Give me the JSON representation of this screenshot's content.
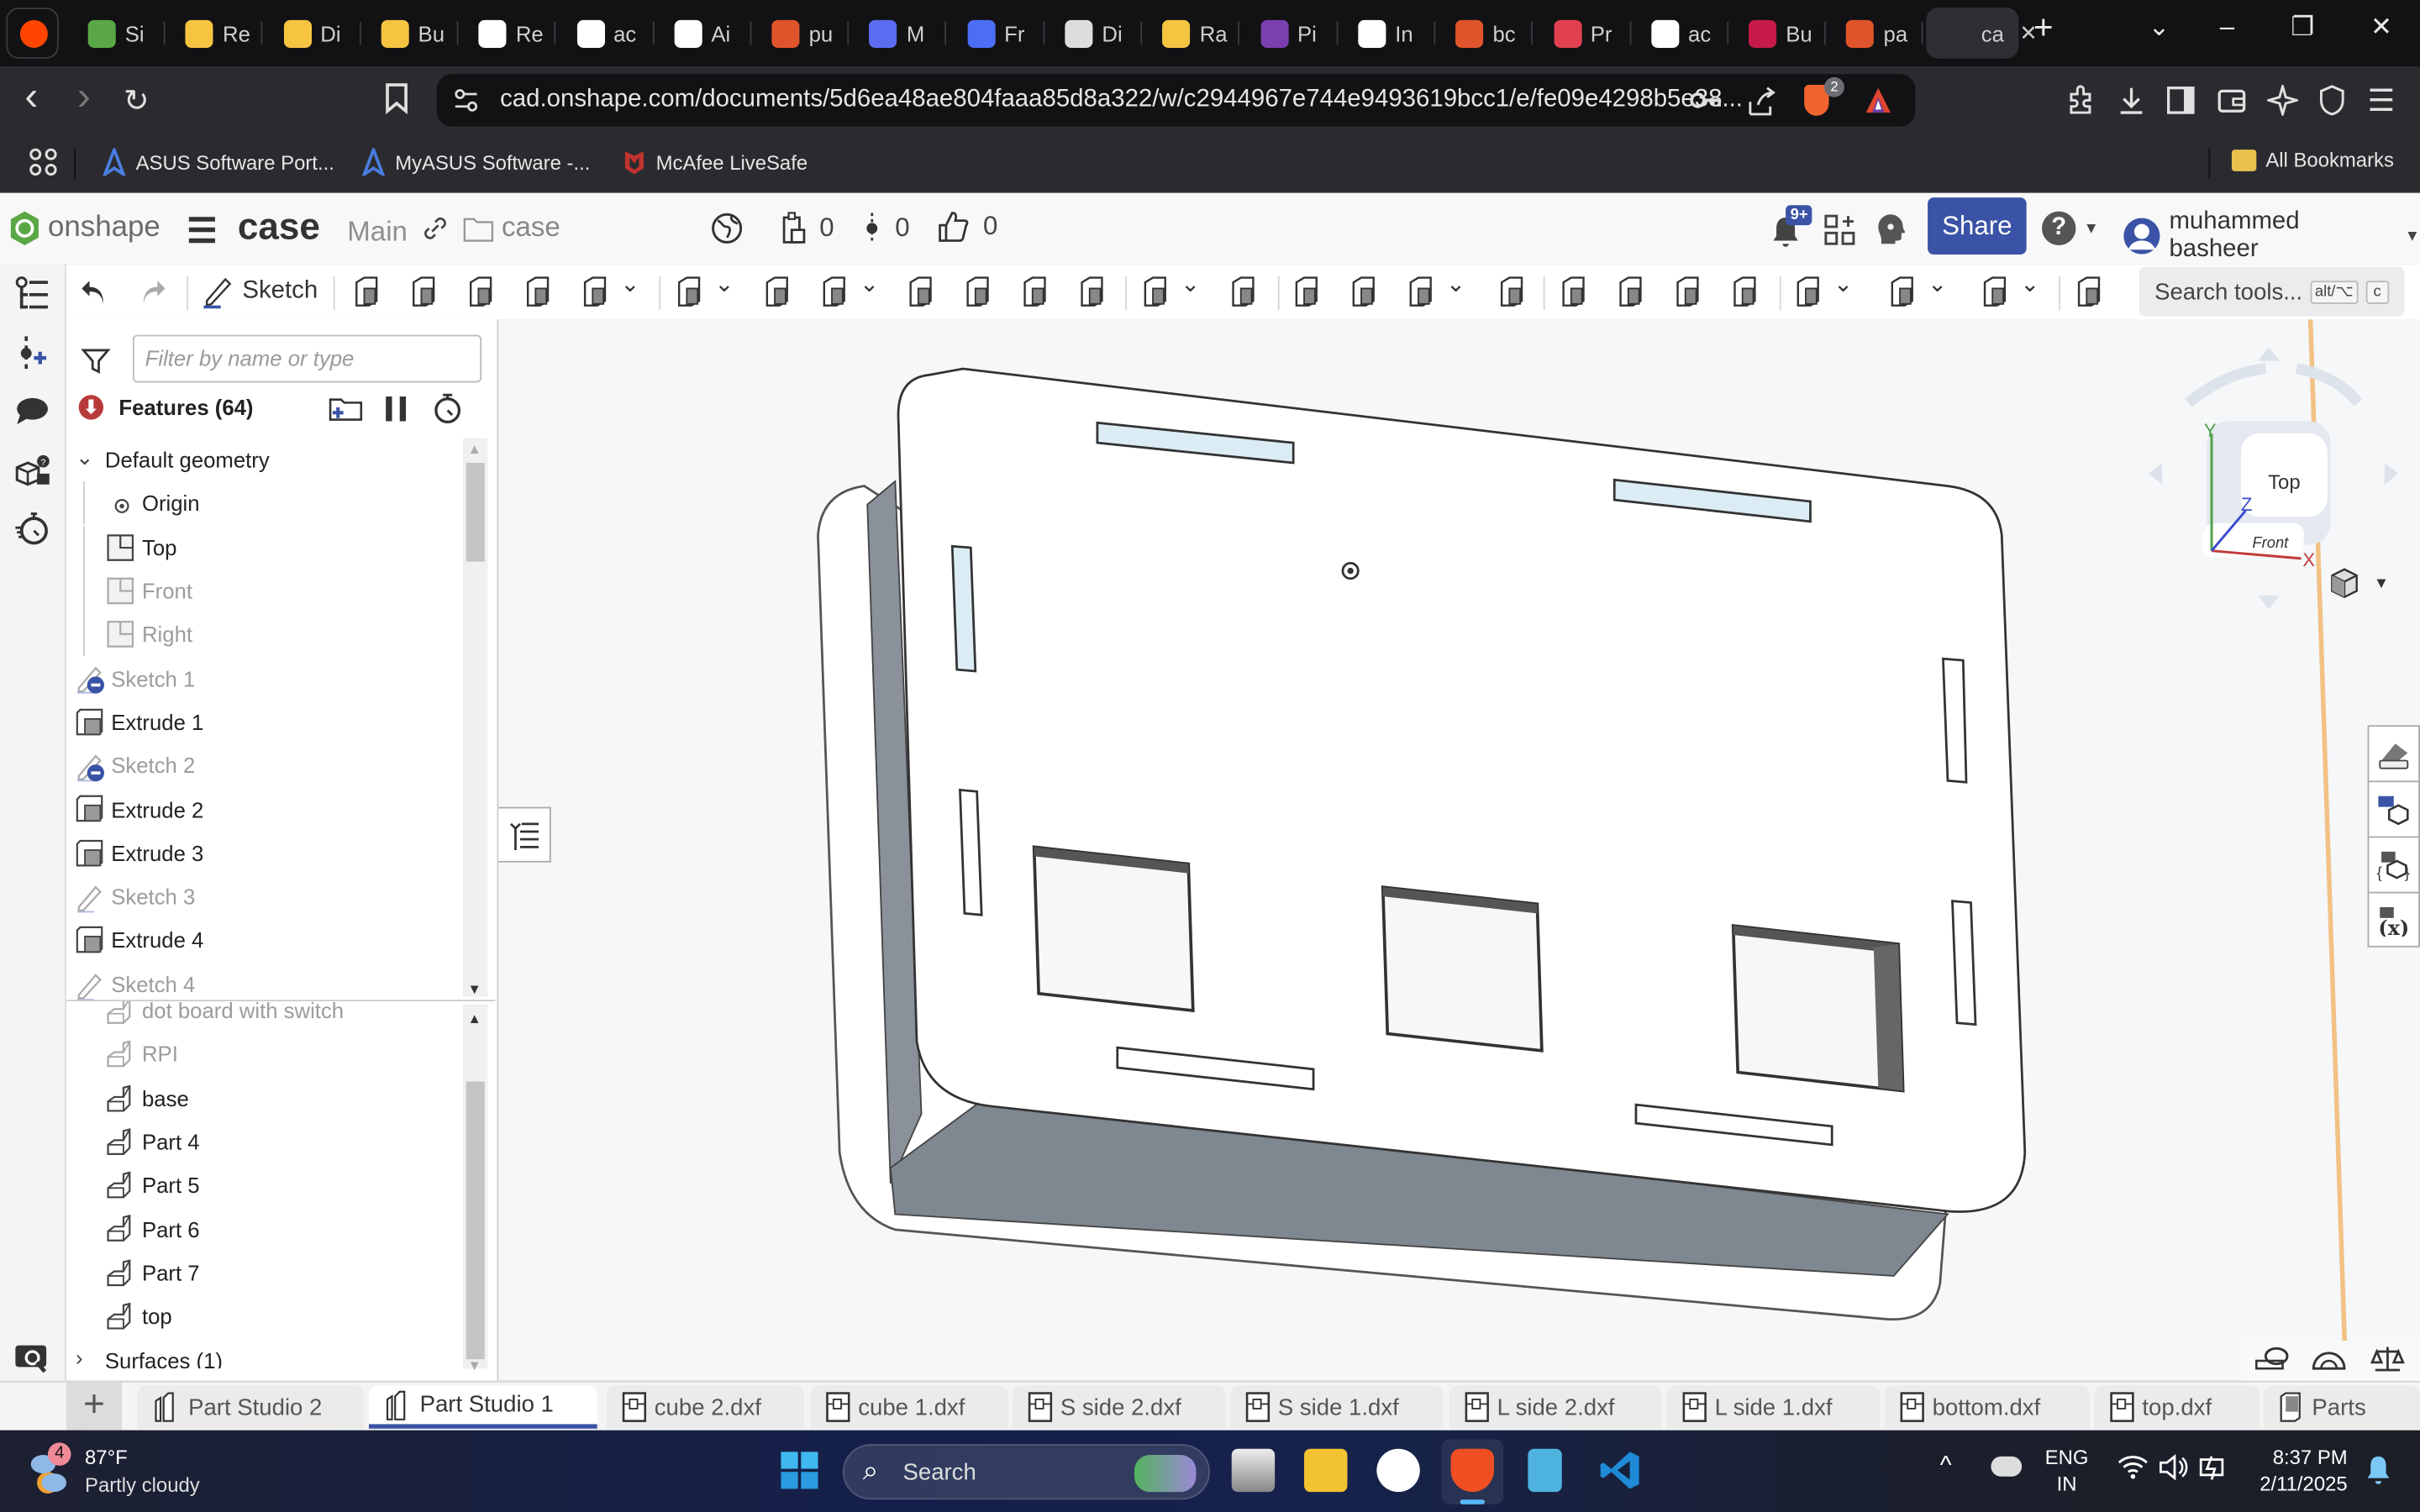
{
  "browser": {
    "tabs": [
      {
        "label": "Reddit",
        "short": "",
        "color": "#ff4500"
      },
      {
        "label": "Si",
        "color": "#5aa845"
      },
      {
        "label": "Re",
        "color": "#f5c542"
      },
      {
        "label": "Di",
        "color": "#f5c542"
      },
      {
        "label": "Bu",
        "color": "#f5c542"
      },
      {
        "label": "Re",
        "color": "#ffffff"
      },
      {
        "label": "ac",
        "color": "#ffffff"
      },
      {
        "label": "Ai",
        "color": "#ffffff"
      },
      {
        "label": "pu",
        "color": "#e0542c"
      },
      {
        "label": "M",
        "color": "#5b6cf0"
      },
      {
        "label": "Fr",
        "color": "#4c6ef5"
      },
      {
        "label": "Di",
        "color": "#dddddd"
      },
      {
        "label": "Ra",
        "color": "#f5c542"
      },
      {
        "label": "Pi",
        "color": "#7c3fb0"
      },
      {
        "label": "In",
        "color": "#ffffff"
      },
      {
        "label": "bc",
        "color": "#e0542c"
      },
      {
        "label": "Pr",
        "color": "#e0404f"
      },
      {
        "label": "ac",
        "color": "#ffffff"
      },
      {
        "label": "Bu",
        "color": "#c51a4a"
      },
      {
        "label": "pa",
        "color": "#e0542c"
      },
      {
        "label": "ca",
        "color": "#2e2e33",
        "active": true
      }
    ],
    "url": "cad.onshape.com/documents/5d6ea48ae804faaa85d8a322/w/c2944967e744e9493619bcc1/e/fe09e4298b5e38...",
    "brave_badge": "2",
    "bookmarks": [
      "ASUS Software Port...",
      "MyASUS Software -...",
      "McAfee LiveSafe"
    ],
    "all_bookmarks": "All Bookmarks",
    "icons": {
      "back": "‹",
      "forward": "›",
      "reload": "↻",
      "new_tab": "+",
      "close_tab": "✕",
      "tab_list": "⌄",
      "minimize": "–",
      "restore": "❐",
      "close": "✕"
    }
  },
  "onshape": {
    "logo": "onshape",
    "doc_title": "case",
    "branch": "Main",
    "folder": "case",
    "counts": {
      "versions": "0",
      "branches": "0",
      "likes": "0"
    },
    "notifications_badge": "9+",
    "share_label": "Share",
    "help_label": "?",
    "user": "muhammed basheer",
    "toolbar": {
      "sketch_label": "Sketch",
      "search_placeholder": "Search tools...",
      "shortcut_alt": "alt/⌥",
      "shortcut_key": "c"
    },
    "panel": {
      "filter_placeholder": "Filter by name or type",
      "features_title": "Features (64)",
      "features": [
        {
          "label": "Default geometry",
          "type": "group",
          "state": "normal"
        },
        {
          "label": "Origin",
          "type": "origin",
          "state": "normal",
          "indent": true
        },
        {
          "label": "Top",
          "type": "plane",
          "state": "normal",
          "indent": true
        },
        {
          "label": "Front",
          "type": "plane",
          "state": "hidden",
          "indent": true
        },
        {
          "label": "Right",
          "type": "plane",
          "state": "hidden",
          "indent": true
        },
        {
          "label": "Sketch 1",
          "type": "sketch-suppressed",
          "state": "hidden"
        },
        {
          "label": "Extrude 1",
          "type": "extrude",
          "state": "normal"
        },
        {
          "label": "Sketch 2",
          "type": "sketch-suppressed",
          "state": "hidden"
        },
        {
          "label": "Extrude 2",
          "type": "extrude",
          "state": "normal"
        },
        {
          "label": "Extrude 3",
          "type": "extrude",
          "state": "normal"
        },
        {
          "label": "Sketch 3",
          "type": "sketch",
          "state": "hidden"
        },
        {
          "label": "Extrude 4",
          "type": "extrude",
          "state": "normal"
        },
        {
          "label": "Sketch 4",
          "type": "sketch",
          "state": "hidden"
        }
      ],
      "parts": [
        {
          "label": "dot board with switch",
          "state": "hidden"
        },
        {
          "label": "RPI",
          "state": "hidden"
        },
        {
          "label": "base",
          "state": "normal"
        },
        {
          "label": "Part 4",
          "state": "normal"
        },
        {
          "label": "Part 5",
          "state": "normal"
        },
        {
          "label": "Part 6",
          "state": "normal"
        },
        {
          "label": "Part 7",
          "state": "normal"
        },
        {
          "label": "top",
          "state": "normal"
        }
      ],
      "surfaces": "Surfaces (1)"
    },
    "viewcube": {
      "top": "Top",
      "front": "Front",
      "x": "X",
      "y": "Y",
      "z": "Z"
    },
    "bottom_tabs": [
      {
        "label": "Part Studio 2",
        "icon": "part-studio"
      },
      {
        "label": "Part Studio 1",
        "icon": "part-studio",
        "active": true
      },
      {
        "label": "cube 2.dxf",
        "icon": "blob"
      },
      {
        "label": "cube 1.dxf",
        "icon": "blob"
      },
      {
        "label": "S side 2.dxf",
        "icon": "blob"
      },
      {
        "label": "S side 1.dxf",
        "icon": "blob"
      },
      {
        "label": "L side 2.dxf",
        "icon": "blob"
      },
      {
        "label": "L side 1.dxf",
        "icon": "blob"
      },
      {
        "label": "bottom.dxf",
        "icon": "blob"
      },
      {
        "label": "top.dxf",
        "icon": "blob"
      },
      {
        "label": "Parts",
        "icon": "parts"
      }
    ],
    "colors": {
      "accent": "#3a53a6",
      "brand_green": "#5aa845",
      "error_red": "#b83b3b"
    }
  },
  "taskbar": {
    "weather_temp": "87°F",
    "weather_desc": "Partly cloudy",
    "weather_badge": "4",
    "search_label": "Search",
    "lang_top": "ENG",
    "lang_bottom": "IN",
    "time": "8:37 PM",
    "date": "2/11/2025"
  }
}
